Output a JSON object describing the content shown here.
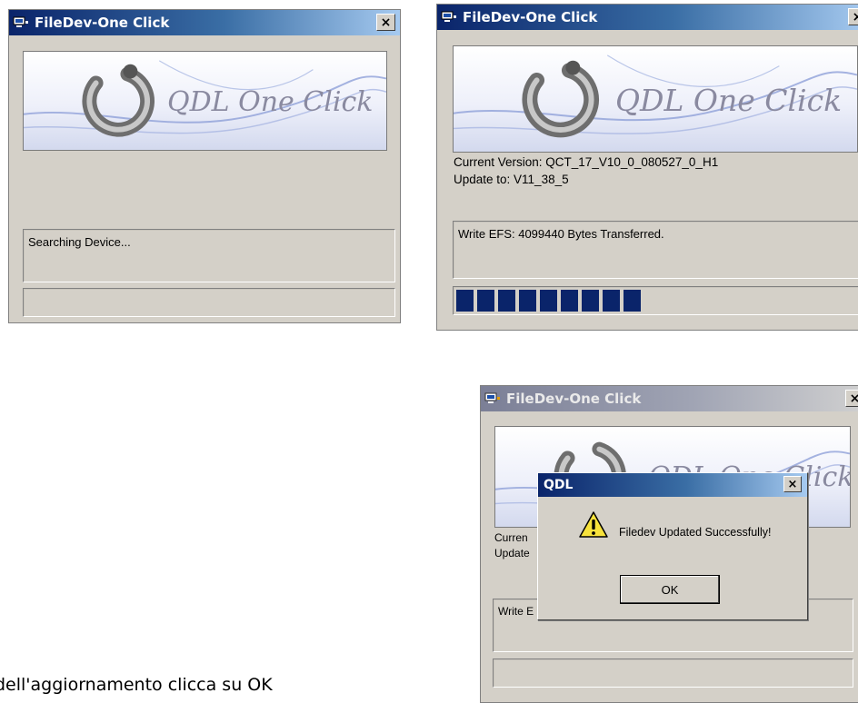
{
  "window_title": "FileDev-One Click",
  "close_glyph": "×",
  "banner_logo_text": "QDL One Click",
  "window_searching": {
    "status_text": "Searching Device..."
  },
  "window_updating": {
    "current_version": "Current Version: QCT_17_V10_0_080527_0_H1",
    "update_to": "Update to: V11_38_5",
    "status_text": "Write EFS: 4099440 Bytes Transferred.",
    "progress_segments_filled": 9
  },
  "window_done": {
    "current_version_partial": "Curren",
    "update_to_partial": "Update",
    "status_text_partial": "Write E"
  },
  "dialog": {
    "title": "QDL",
    "message": "Filedev Updated Successfully!",
    "ok_label": "OK",
    "icon": "warning-icon"
  },
  "caption_text": "dell'aggiornamento clicca su OK"
}
